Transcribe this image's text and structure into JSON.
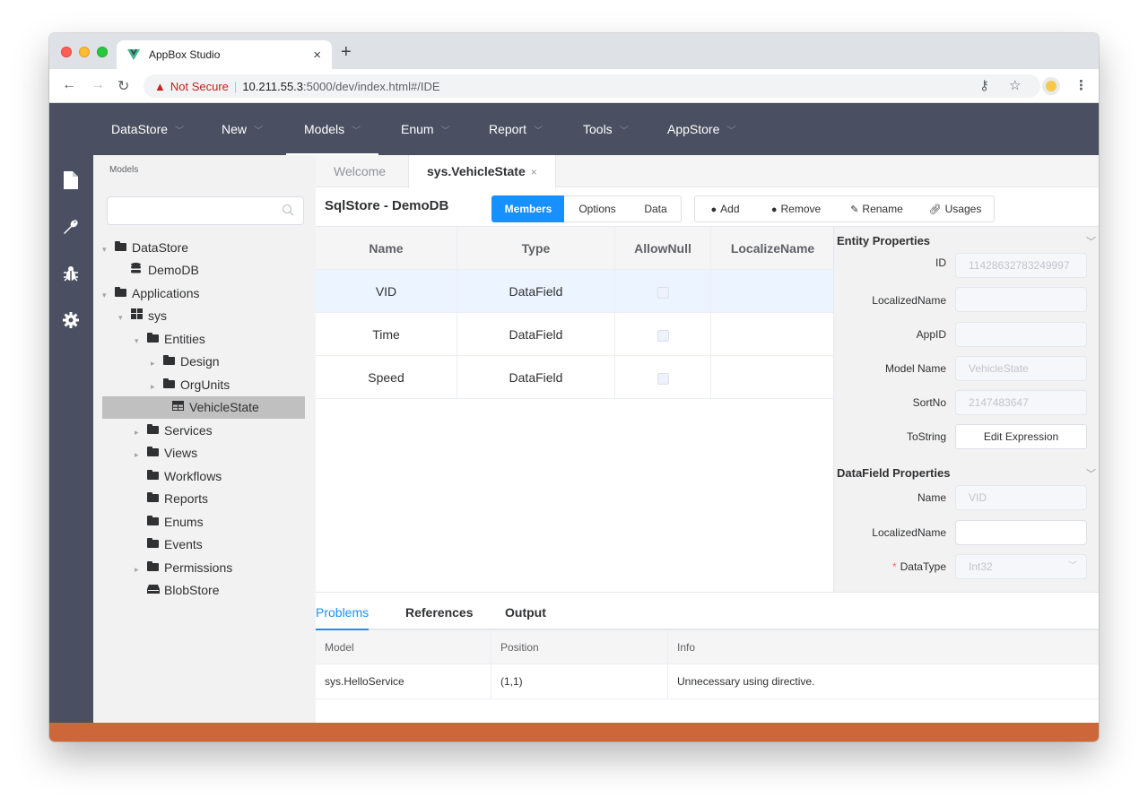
{
  "browser": {
    "tab_title": "AppBox Studio",
    "tab_close": "×",
    "new_tab": "+",
    "not_secure": "Not Secure",
    "url_host": "10.211.55.3",
    "url_rest": ":5000/dev/index.html#/IDE"
  },
  "menu": [
    {
      "label": "DataStore",
      "active": false
    },
    {
      "label": "New",
      "active": false
    },
    {
      "label": "Models",
      "active": true
    },
    {
      "label": "Enum",
      "active": false
    },
    {
      "label": "Report",
      "active": false
    },
    {
      "label": "Tools",
      "active": false
    },
    {
      "label": "AppStore",
      "active": false
    }
  ],
  "sidebar_icons": [
    "file-icon",
    "wrench-icon",
    "bug-icon",
    "gear-icon"
  ],
  "tree": {
    "title": "Models",
    "search_placeholder": "",
    "nodes": [
      {
        "label": "DataStore",
        "caret": "▾",
        "icon": "folder"
      },
      {
        "label": "DemoDB",
        "caret": "",
        "icon": "database"
      },
      {
        "label": "Applications",
        "caret": "▾",
        "icon": "folder"
      },
      {
        "label": "sys",
        "caret": "▾",
        "icon": "app"
      },
      {
        "label": "Entities",
        "caret": "▾",
        "icon": "folder"
      },
      {
        "label": "Design",
        "caret": "▸",
        "icon": "folder"
      },
      {
        "label": "OrgUnits",
        "caret": "▸",
        "icon": "folder"
      },
      {
        "label": "VehicleState",
        "caret": "",
        "icon": "table",
        "selected": true
      },
      {
        "label": "Services",
        "caret": "▸",
        "icon": "folder"
      },
      {
        "label": "Views",
        "caret": "▸",
        "icon": "folder"
      },
      {
        "label": "Workflows",
        "caret": "",
        "icon": "folder"
      },
      {
        "label": "Reports",
        "caret": "",
        "icon": "folder"
      },
      {
        "label": "Enums",
        "caret": "",
        "icon": "folder"
      },
      {
        "label": "Events",
        "caret": "",
        "icon": "folder"
      },
      {
        "label": "Permissions",
        "caret": "▸",
        "icon": "folder"
      },
      {
        "label": "BlobStore",
        "caret": "",
        "icon": "blob"
      }
    ]
  },
  "doc_tabs": {
    "welcome": "Welcome",
    "active": "sys.VehicleState",
    "close": "×"
  },
  "designer": {
    "store_title": "SqlStore - DemoDB",
    "view_buttons": [
      "Members",
      "Options",
      "Data"
    ],
    "actions": [
      "Add",
      "Remove",
      "Rename",
      "Usages"
    ]
  },
  "members": {
    "columns": [
      "Name",
      "Type",
      "AllowNull",
      "LocalizeName"
    ],
    "rows": [
      {
        "name": "VID",
        "type": "DataField",
        "allow_null": false,
        "localize": ""
      },
      {
        "name": "Time",
        "type": "DataField",
        "allow_null": false,
        "localize": ""
      },
      {
        "name": "Speed",
        "type": "DataField",
        "allow_null": false,
        "localize": ""
      }
    ]
  },
  "entity_props": {
    "title": "Entity Properties",
    "id_label": "ID",
    "id_value": "11428632783249997",
    "localized_label": "LocalizedName",
    "localized_value": "",
    "appid_label": "AppID",
    "appid_value": "",
    "model_name_label": "Model Name",
    "model_name_value": "VehicleState",
    "sortno_label": "SortNo",
    "sortno_value": "2147483647",
    "tostring_label": "ToString",
    "tostring_button": "Edit Expression"
  },
  "datafield_props": {
    "title": "DataField Properties",
    "name_label": "Name",
    "name_value": "VID",
    "localized_label": "LocalizedName",
    "localized_value": "",
    "datatype_req": "*",
    "datatype_label": "DataType",
    "datatype_value": "Int32"
  },
  "bottom": {
    "tabs": [
      "Problems",
      "References",
      "Output"
    ],
    "columns": [
      "Model",
      "Position",
      "Info"
    ],
    "rows": [
      {
        "model": "sys.HelloService",
        "position": "(1,1)",
        "info": "Unnecessary using directive."
      }
    ]
  },
  "colors": {
    "menu_bg": "#4a5061",
    "accent": "#1890ff",
    "status_bar": "#cd6639",
    "selected_row": "#ecf5ff"
  }
}
